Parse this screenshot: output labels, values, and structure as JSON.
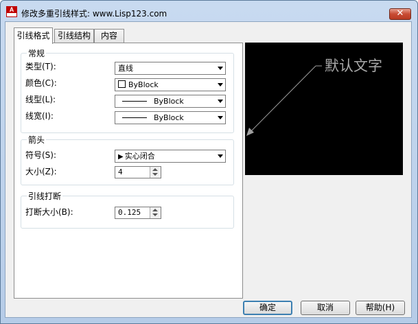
{
  "window": {
    "title": "修改多重引线样式: www.Lisp123.com",
    "app_icon_letter": "A",
    "close_glyph": "✕"
  },
  "tabs": [
    {
      "label": "引线格式",
      "active": true
    },
    {
      "label": "引线结构",
      "active": false
    },
    {
      "label": "内容",
      "active": false
    }
  ],
  "general": {
    "heading": "常规",
    "type_label": "类型(T):",
    "type_value": "直线",
    "color_label": "颜色(C):",
    "color_value": "ByBlock",
    "linetype_label": "线型(L):",
    "linetype_value": "ByBlock",
    "lineweight_label": "线宽(I):",
    "lineweight_value": "ByBlock"
  },
  "arrowhead": {
    "heading": "箭头",
    "symbol_label": "符号(S):",
    "symbol_value": "实心闭合",
    "size_label": "大小(Z):",
    "size_value": "4"
  },
  "landing_break": {
    "heading": "引线打断",
    "break_size_label": "打断大小(B):",
    "break_size_value": "0.125"
  },
  "preview": {
    "text": "默认文字",
    "text_color": "#a9a9a9",
    "leader_color": "#a0a0a0",
    "background": "#000000"
  },
  "buttons": {
    "ok": "确定",
    "cancel": "取消",
    "help": "帮助(H)"
  },
  "icons": {
    "swatch": "white-square-icon",
    "arrow": "filled-arrowhead-icon"
  }
}
